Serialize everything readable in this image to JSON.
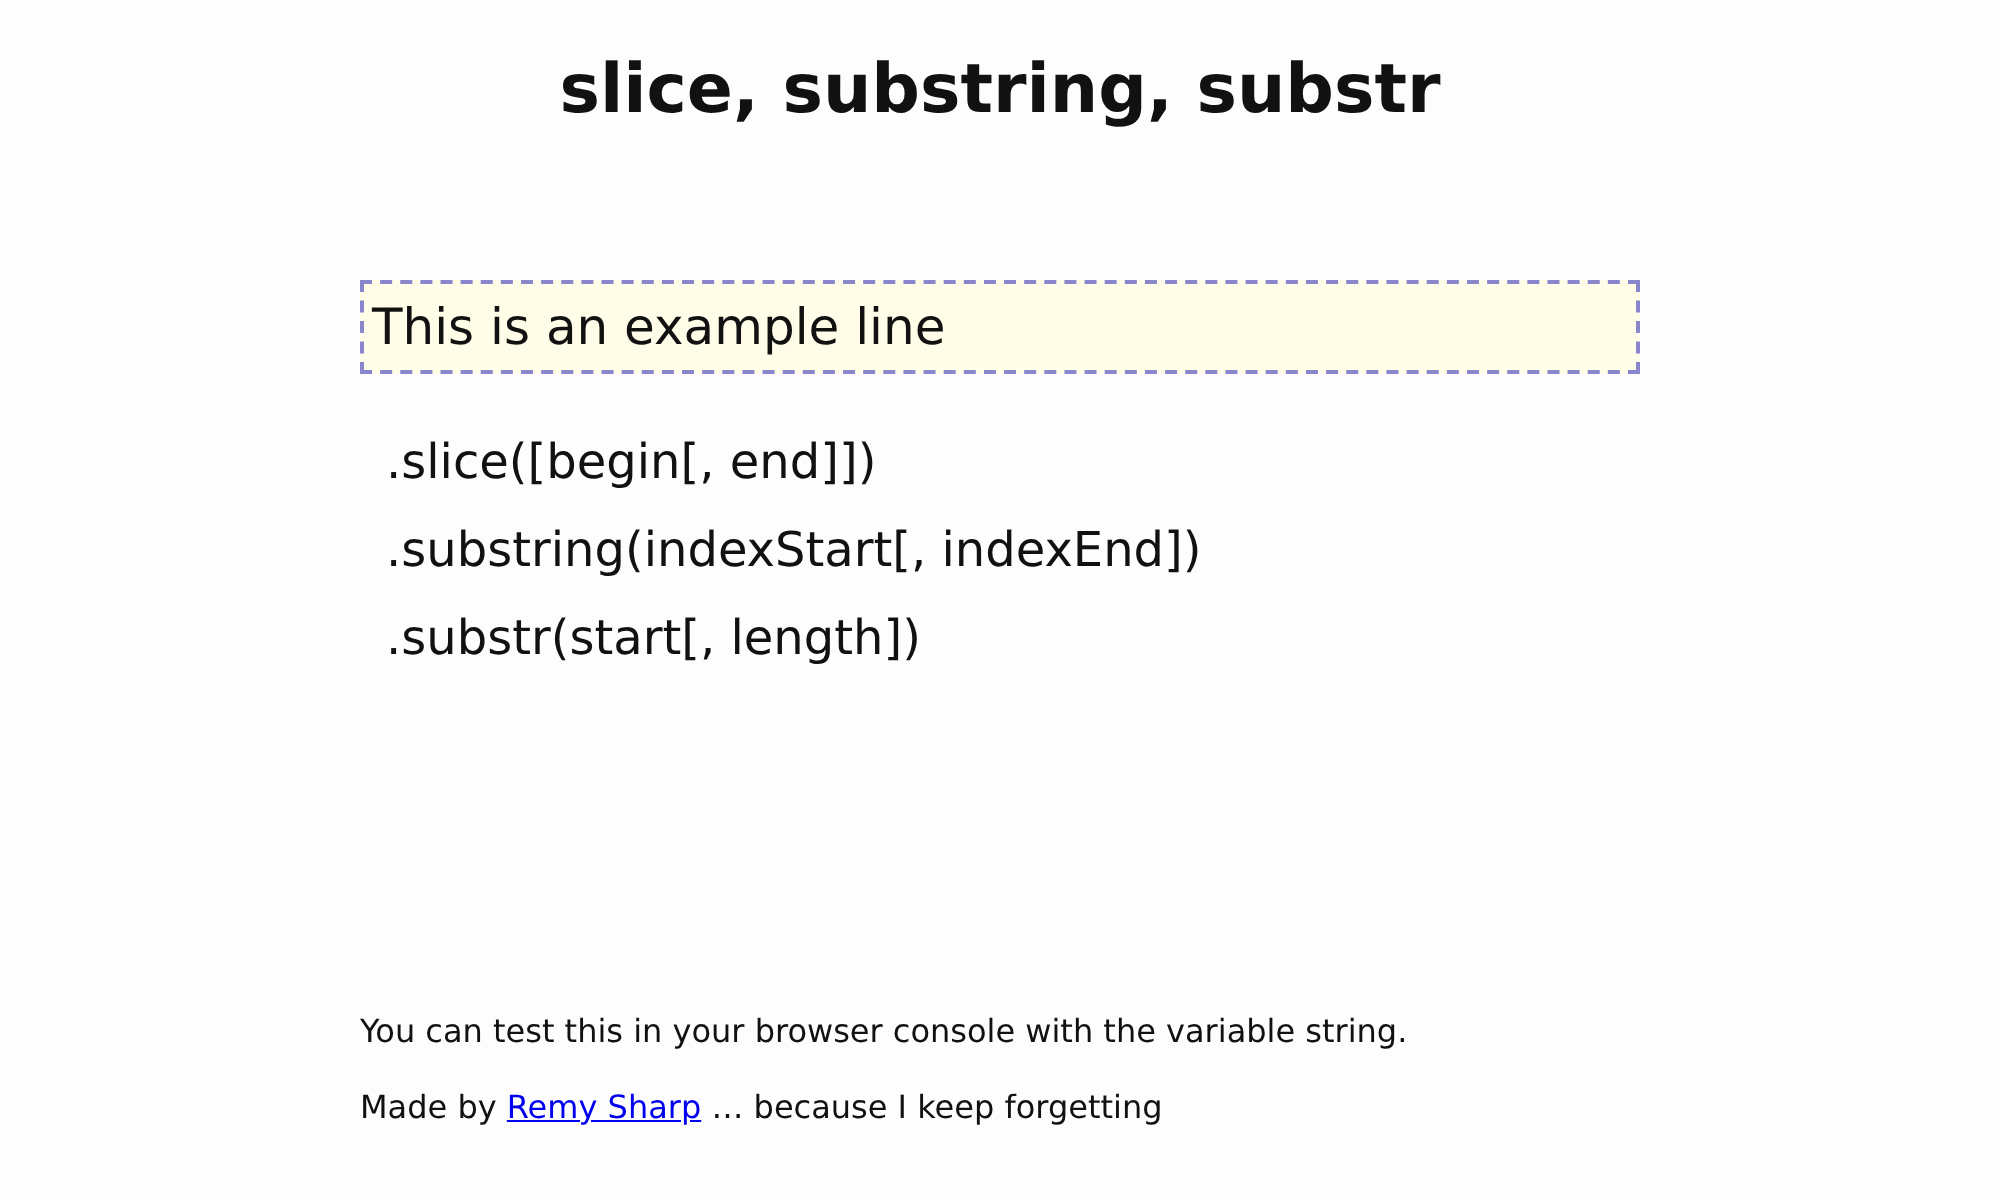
{
  "title": "slice, substring, substr",
  "example": {
    "text": "This is an example line"
  },
  "methods": [
    {
      "signature": ".slice([begin[, end]])"
    },
    {
      "signature": ".substring(indexStart[, indexEnd])"
    },
    {
      "signature": ".substr(start[, length])"
    }
  ],
  "note": "You can test this in your browser console with the variable string.",
  "credit": {
    "prefix": "Made by ",
    "link": "Remy Sharp",
    "suffix": " … because I keep forgetting"
  }
}
